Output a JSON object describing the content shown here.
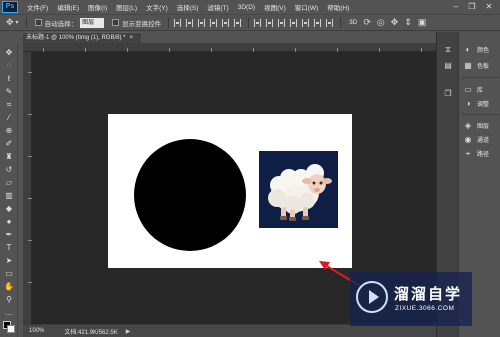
{
  "app": {
    "logo_text": "Ps"
  },
  "menu": [
    "文件(F)",
    "编辑(E)",
    "图像(I)",
    "图层(L)",
    "文字(Y)",
    "选择(S)",
    "滤镜(T)",
    "3D(D)",
    "视图(V)",
    "窗口(W)",
    "帮助(H)"
  ],
  "window_controls": [
    "minimize",
    "restore",
    "close"
  ],
  "options_bar": {
    "auto_select_label": "自动选择：",
    "auto_select_value": "图层",
    "show_transform_label": "显示变换控件"
  },
  "document": {
    "tab_title": "未标题-1 @ 100% (timg (1), RGB/8) *",
    "close_glyph": "×"
  },
  "tools": [
    "move-icon",
    "marquee-icon",
    "lasso-icon",
    "quick-select-icon",
    "crop-icon",
    "eyedropper-icon",
    "healing-icon",
    "brush-icon",
    "stamp-icon",
    "history-brush-icon",
    "eraser-icon",
    "gradient-icon",
    "blur-icon",
    "dodge-icon",
    "pen-icon",
    "type-icon",
    "path-select-icon",
    "shape-icon",
    "hand-icon",
    "zoom-icon"
  ],
  "status": {
    "zoom": "100%",
    "doc_info": "文档:421.9K/562.5K",
    "arrow": "▶"
  },
  "panels": {
    "dock_icons": [
      "history-icon",
      "properties-icon",
      "layers-comp-icon"
    ],
    "buttons": [
      {
        "icon": "color-icon",
        "label": "颜色"
      },
      {
        "icon": "swatches-icon",
        "label": "色板"
      },
      {
        "icon": "library-icon",
        "label": "库"
      },
      {
        "icon": "adjustments-icon",
        "label": "调整"
      },
      {
        "icon": "layers-icon",
        "label": "图层"
      },
      {
        "icon": "channels-icon",
        "label": "通道"
      },
      {
        "icon": "paths-icon",
        "label": "路径"
      }
    ]
  },
  "watermark": {
    "title": "溜溜自学",
    "url": "ZIXUE.3066.COM"
  },
  "colors": {
    "canvas": "#ffffff",
    "circle": "#000000",
    "sheep_bg": "#0e1e45",
    "arrow": "#d81e1e"
  }
}
